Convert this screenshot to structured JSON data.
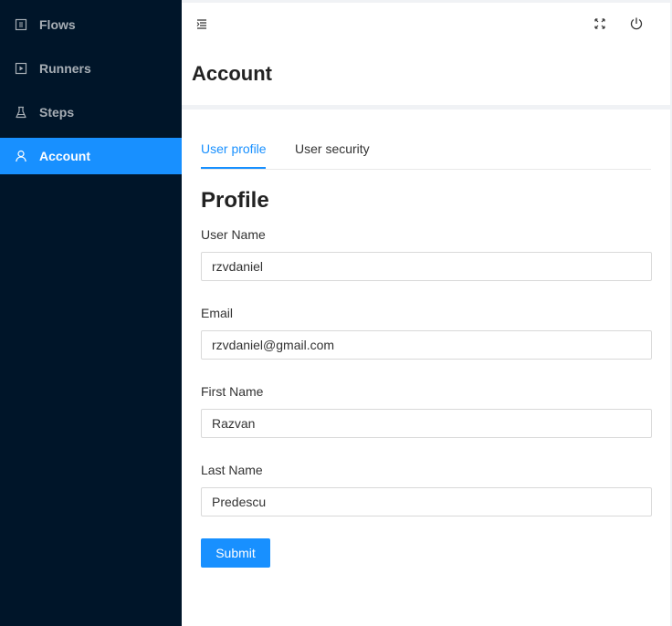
{
  "sidebar": {
    "items": [
      {
        "label": "Flows",
        "icon": "flows-icon",
        "active": false
      },
      {
        "label": "Runners",
        "icon": "play-square-icon",
        "active": false
      },
      {
        "label": "Steps",
        "icon": "flask-icon",
        "active": false
      },
      {
        "label": "Account",
        "icon": "user-icon",
        "active": true
      }
    ]
  },
  "header": {
    "menu_toggle_icon": "menu-fold-icon",
    "fullscreen_icon": "fullscreen-icon",
    "logout_icon": "power-icon"
  },
  "page": {
    "title": "Account"
  },
  "tabs": [
    {
      "label": "User profile",
      "active": true
    },
    {
      "label": "User security",
      "active": false
    }
  ],
  "profile": {
    "title": "Profile",
    "fields": [
      {
        "label": "User Name",
        "value": "rzvdaniel"
      },
      {
        "label": "Email",
        "value": "rzvdaniel@gmail.com"
      },
      {
        "label": "First Name",
        "value": "Razvan"
      },
      {
        "label": "Last Name",
        "value": "Predescu"
      }
    ],
    "submit_label": "Submit"
  },
  "colors": {
    "sidebar_bg": "#001529",
    "accent": "#1890ff"
  }
}
